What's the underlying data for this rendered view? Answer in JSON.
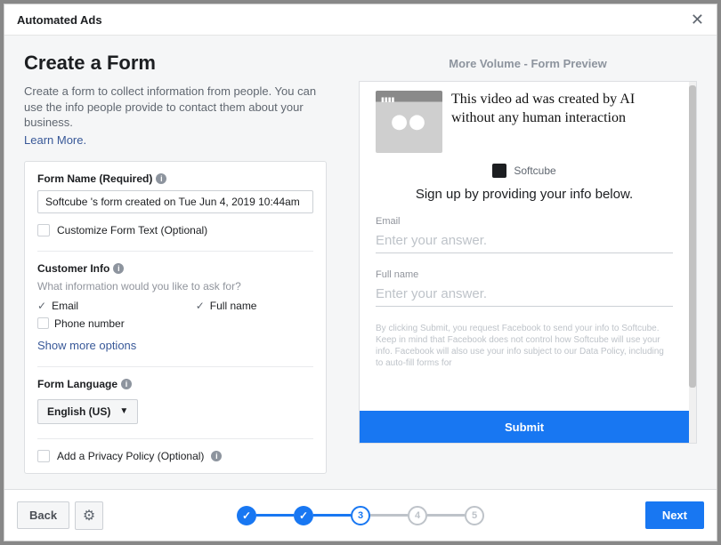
{
  "modal": {
    "title": "Automated Ads"
  },
  "header": {
    "title": "Create a Form",
    "subtitle": "Create a form to collect information from people. You can use the info people provide to contact them about your business.",
    "learn_more": "Learn More."
  },
  "form_name": {
    "label": "Form Name (Required)",
    "value": "Softcube 's form created on Tue Jun 4, 2019 10:44am"
  },
  "customize_text": {
    "label": "Customize Form Text (Optional)"
  },
  "customer_info": {
    "label": "Customer Info",
    "hint": "What information would you like to ask for?",
    "email": "Email",
    "phone": "Phone number",
    "fullname": "Full name",
    "show_more": "Show more options"
  },
  "form_language": {
    "label": "Form Language",
    "value": "English (US)"
  },
  "privacy": {
    "label": "Add a Privacy Policy (Optional)"
  },
  "preview": {
    "heading": "More Volume - Form Preview",
    "video_caption": "This video ad was created by AI without any human interaction",
    "brand": "Softcube",
    "signup": "Sign up by providing your info below.",
    "email_label": "Email",
    "email_placeholder": "Enter your answer.",
    "fullname_label": "Full name",
    "fullname_placeholder": "Enter your answer.",
    "legal": "By clicking Submit, you request Facebook to send your info to Softcube. Keep in mind that Facebook does not control how Softcube will use your info. Facebook will also use your info subject to our Data Policy, including to auto-fill forms for",
    "submit": "Submit"
  },
  "footer": {
    "back": "Back",
    "next": "Next",
    "steps": {
      "current": "3",
      "s4": "4",
      "s5": "5"
    }
  }
}
